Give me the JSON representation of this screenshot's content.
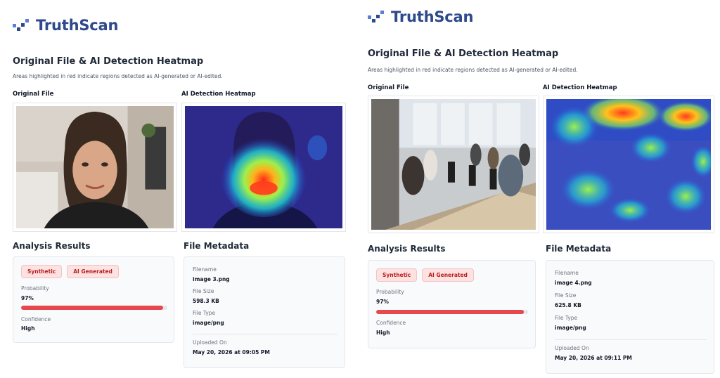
{
  "panels": [
    {
      "brand": {
        "name": "TruthScan",
        "logo_icon": "pixel-check-logo-icon"
      },
      "section_title": "Original File & AI Detection Heatmap",
      "section_subtitle": "Areas highlighted in red indicate regions detected as AI-generated or AI-edited.",
      "original_label": "Original File",
      "heatmap_label": "AI Detection Heatmap",
      "original_image": "selfie-portrait-image",
      "heatmap_image": "selfie-heatmap-overlay-image",
      "analysis": {
        "title": "Analysis Results",
        "badges": [
          "Synthetic",
          "AI Generated"
        ],
        "probability_label": "Probability",
        "probability_value": "97%",
        "probability_fraction": 0.97,
        "confidence_label": "Confidence",
        "confidence_value": "High"
      },
      "metadata": {
        "title": "File Metadata",
        "filename_label": "Filename",
        "filename_value": "image 3.png",
        "filesize_label": "File Size",
        "filesize_value": "598.3 KB",
        "filetype_label": "File Type",
        "filetype_value": "image/png",
        "uploaded_label": "Uploaded On",
        "uploaded_value": "May 20, 2026 at 09:05 PM"
      }
    },
    {
      "brand": {
        "name": "TruthScan",
        "logo_icon": "pixel-check-logo-icon"
      },
      "section_title": "Original File & AI Detection Heatmap",
      "section_subtitle": "Areas highlighted in red indicate regions detected as AI-generated or AI-edited.",
      "original_label": "Original File",
      "heatmap_label": "AI Detection Heatmap",
      "original_image": "office-photo-image",
      "heatmap_image": "office-heatmap-overlay-image",
      "analysis": {
        "title": "Analysis Results",
        "badges": [
          "Synthetic",
          "AI Generated"
        ],
        "probability_label": "Probability",
        "probability_value": "97%",
        "probability_fraction": 0.97,
        "confidence_label": "Confidence",
        "confidence_value": "High"
      },
      "metadata": {
        "title": "File Metadata",
        "filename_label": "Filename",
        "filename_value": "image 4.png",
        "filesize_label": "File Size",
        "filesize_value": "625.8 KB",
        "filetype_label": "File Type",
        "filetype_value": "image/png",
        "uploaded_label": "Uploaded On",
        "uploaded_value": "May 20, 2026 at 09:11 PM"
      }
    }
  ],
  "colors": {
    "brand": "#2e4a8a",
    "badge_bg": "#fde2e2",
    "badge_text": "#b91c1c",
    "progress": "#e5484d",
    "card_bg": "#f9fafb"
  }
}
